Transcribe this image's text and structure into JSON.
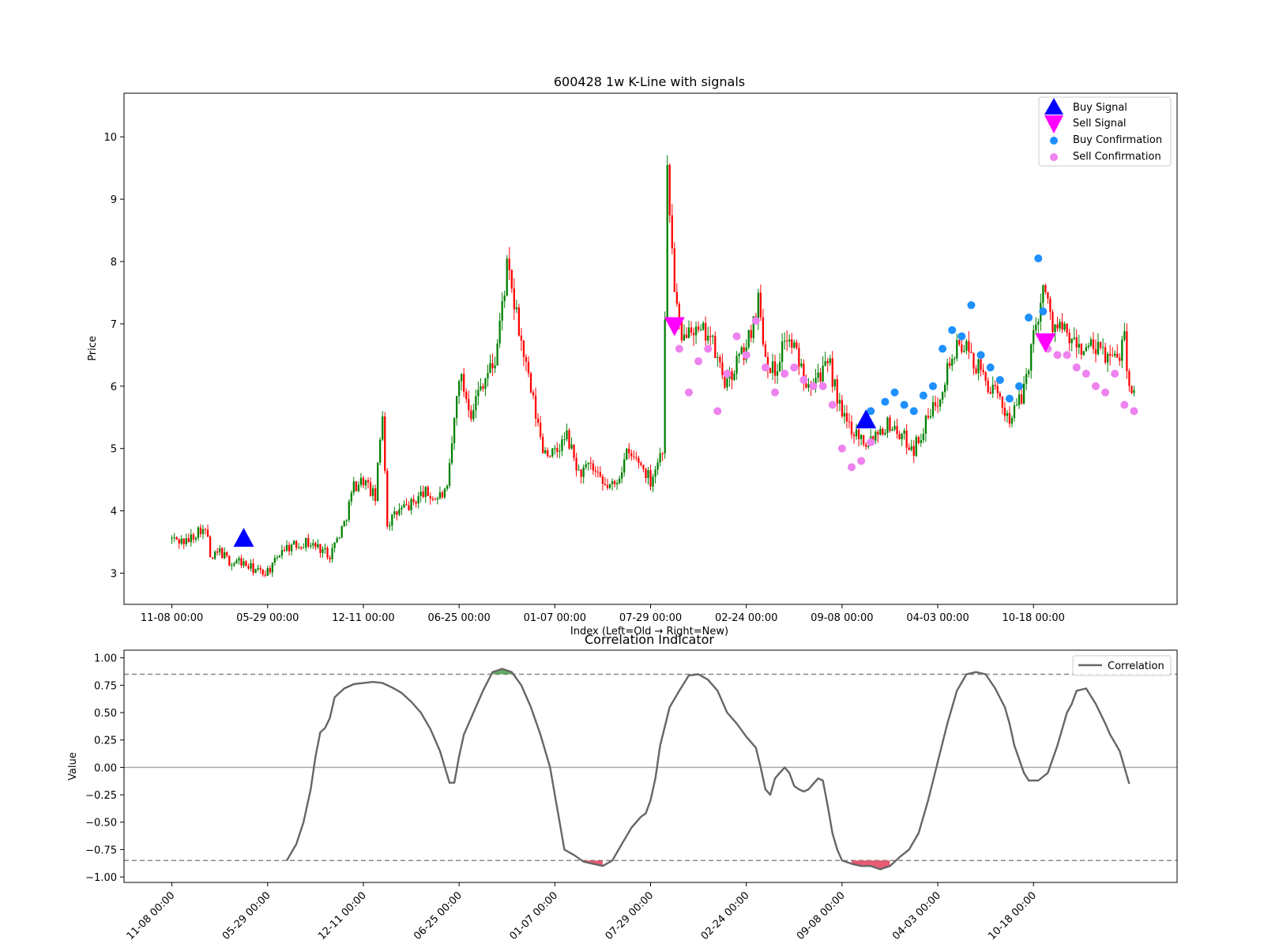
{
  "chart_data": [
    {
      "type": "candlestick",
      "title": "600428 1w K-Line with signals",
      "xlabel": "Index (Left=Old → Right=New)",
      "ylabel": "Price",
      "ylim": [
        2.5,
        10.7
      ],
      "y_ticks": [
        3,
        4,
        5,
        6,
        7,
        8,
        9,
        10
      ],
      "x_tick_labels": [
        "11-08 00:00",
        "05-29 00:00",
        "12-11 00:00",
        "06-25 00:00",
        "01-07 00:00",
        "07-29 00:00",
        "02-24 00:00",
        "09-08 00:00",
        "04-03 00:00",
        "10-18 00:00"
      ],
      "x_tick_index": [
        0,
        40,
        80,
        120,
        160,
        200,
        240,
        280,
        320,
        360
      ],
      "xlim": [
        -20,
        420
      ],
      "colors": {
        "up": "#008000",
        "down": "#ff0000",
        "buy_signal": "#0000ff",
        "sell_signal": "#ff00ff",
        "buy_confirmation": "#1e90ff",
        "sell_confirmation": "#ee82ee"
      },
      "legend": {
        "placement": "top-right",
        "items": [
          "Buy Signal",
          "Sell Signal",
          "Buy Confirmation",
          "Sell Confirmation"
        ]
      },
      "price_path": [
        [
          0,
          3.55
        ],
        [
          6,
          3.5
        ],
        [
          12,
          3.72
        ],
        [
          15,
          3.6
        ],
        [
          16,
          3.2
        ],
        [
          20,
          3.35
        ],
        [
          25,
          3.15
        ],
        [
          28,
          3.2
        ],
        [
          32,
          3.1
        ],
        [
          38,
          3.0
        ],
        [
          42,
          3.1
        ],
        [
          46,
          3.4
        ],
        [
          52,
          3.45
        ],
        [
          56,
          3.5
        ],
        [
          62,
          3.4
        ],
        [
          66,
          3.3
        ],
        [
          72,
          3.8
        ],
        [
          76,
          4.4
        ],
        [
          80,
          4.5
        ],
        [
          85,
          4.2
        ],
        [
          88,
          5.6
        ],
        [
          90,
          3.8
        ],
        [
          95,
          4.0
        ],
        [
          100,
          4.1
        ],
        [
          105,
          4.3
        ],
        [
          110,
          4.2
        ],
        [
          115,
          4.3
        ],
        [
          120,
          6.2
        ],
        [
          125,
          5.6
        ],
        [
          130,
          6.1
        ],
        [
          135,
          6.4
        ],
        [
          140,
          7.9
        ],
        [
          145,
          6.9
        ],
        [
          150,
          5.9
        ],
        [
          155,
          5.0
        ],
        [
          160,
          4.9
        ],
        [
          165,
          5.2
        ],
        [
          170,
          4.6
        ],
        [
          175,
          4.7
        ],
        [
          180,
          4.4
        ],
        [
          185,
          4.4
        ],
        [
          190,
          4.9
        ],
        [
          195,
          4.8
        ],
        [
          200,
          4.5
        ],
        [
          205,
          5.0
        ],
        [
          207,
          9.4
        ],
        [
          210,
          7.6
        ],
        [
          213,
          6.6
        ],
        [
          216,
          7.1
        ],
        [
          220,
          6.8
        ],
        [
          224,
          6.9
        ],
        [
          228,
          6.4
        ],
        [
          232,
          6.0
        ],
        [
          236,
          6.4
        ],
        [
          240,
          6.6
        ],
        [
          245,
          7.4
        ],
        [
          248,
          6.5
        ],
        [
          252,
          6.2
        ],
        [
          256,
          6.8
        ],
        [
          260,
          6.6
        ],
        [
          265,
          6.1
        ],
        [
          270,
          6.2
        ],
        [
          275,
          6.3
        ],
        [
          280,
          5.5
        ],
        [
          285,
          5.3
        ],
        [
          290,
          5.1
        ],
        [
          295,
          5.3
        ],
        [
          300,
          5.4
        ],
        [
          305,
          5.2
        ],
        [
          310,
          5.0
        ],
        [
          315,
          5.4
        ],
        [
          320,
          5.8
        ],
        [
          325,
          6.4
        ],
        [
          330,
          6.7
        ],
        [
          335,
          6.4
        ],
        [
          340,
          6.1
        ],
        [
          345,
          5.8
        ],
        [
          350,
          5.5
        ],
        [
          355,
          5.8
        ],
        [
          360,
          6.8
        ],
        [
          364,
          7.6
        ],
        [
          368,
          7.0
        ],
        [
          372,
          6.9
        ],
        [
          376,
          6.7
        ],
        [
          380,
          6.6
        ],
        [
          385,
          6.6
        ],
        [
          390,
          6.5
        ],
        [
          395,
          6.4
        ],
        [
          398,
          6.9
        ],
        [
          400,
          5.9
        ],
        [
          402,
          6.0
        ]
      ],
      "buy_signals": [
        [
          30,
          3.55
        ],
        [
          290,
          5.45
        ]
      ],
      "sell_signals": [
        [
          210,
          6.98
        ],
        [
          365,
          6.72
        ]
      ],
      "buy_confirmations": [
        [
          292,
          5.6
        ],
        [
          298,
          5.75
        ],
        [
          302,
          5.9
        ],
        [
          306,
          5.7
        ],
        [
          310,
          5.6
        ],
        [
          314,
          5.85
        ],
        [
          318,
          6.0
        ],
        [
          322,
          6.6
        ],
        [
          326,
          6.9
        ],
        [
          330,
          6.8
        ],
        [
          334,
          7.3
        ],
        [
          338,
          6.5
        ],
        [
          342,
          6.3
        ],
        [
          346,
          6.1
        ],
        [
          350,
          5.8
        ],
        [
          354,
          6.0
        ],
        [
          358,
          7.1
        ],
        [
          362,
          8.05
        ],
        [
          364,
          7.2
        ]
      ],
      "sell_confirmations": [
        [
          212,
          6.6
        ],
        [
          216,
          5.9
        ],
        [
          220,
          6.4
        ],
        [
          224,
          6.6
        ],
        [
          228,
          5.6
        ],
        [
          232,
          6.2
        ],
        [
          236,
          6.8
        ],
        [
          240,
          6.5
        ],
        [
          244,
          7.05
        ],
        [
          248,
          6.3
        ],
        [
          252,
          5.9
        ],
        [
          256,
          6.2
        ],
        [
          260,
          6.3
        ],
        [
          264,
          6.1
        ],
        [
          268,
          6.0
        ],
        [
          272,
          6.0
        ],
        [
          276,
          5.7
        ],
        [
          280,
          5.0
        ],
        [
          284,
          4.7
        ],
        [
          288,
          4.8
        ],
        [
          292,
          5.1
        ],
        [
          366,
          6.6
        ],
        [
          370,
          6.5
        ],
        [
          374,
          6.5
        ],
        [
          378,
          6.3
        ],
        [
          382,
          6.2
        ],
        [
          386,
          6.0
        ],
        [
          390,
          5.9
        ],
        [
          394,
          6.2
        ],
        [
          398,
          5.7
        ],
        [
          402,
          5.6
        ]
      ]
    },
    {
      "type": "line",
      "title": "Correlation Indicator",
      "xlabel": "",
      "ylabel": "Value",
      "ylim": [
        -1.0,
        1.0
      ],
      "y_ticks": [
        -1.0,
        -0.75,
        -0.5,
        -0.25,
        0.0,
        0.25,
        0.5,
        0.75,
        1.0
      ],
      "y_tick_labels": [
        "−1.00",
        "−0.75",
        "−0.50",
        "−0.25",
        "0.00",
        "0.25",
        "0.50",
        "0.75",
        "1.00"
      ],
      "x_tick_labels": [
        "11-08 00:00",
        "05-29 00:00",
        "12-11 00:00",
        "06-25 00:00",
        "01-07 00:00",
        "07-29 00:00",
        "02-24 00:00",
        "09-08 00:00",
        "04-03 00:00",
        "10-18 00:00"
      ],
      "x_tick_index": [
        0,
        40,
        80,
        120,
        160,
        200,
        240,
        280,
        320,
        360
      ],
      "xlim": [
        -20,
        420
      ],
      "thresholds": [
        0.85,
        -0.85
      ],
      "grid": false,
      "legend": {
        "placement": "top-right",
        "items": [
          "Correlation"
        ]
      },
      "series": [
        {
          "name": "Correlation",
          "color": "#666666",
          "points": [
            [
              48,
              -0.85
            ],
            [
              52,
              -0.7
            ],
            [
              55,
              -0.5
            ],
            [
              58,
              -0.2
            ],
            [
              60,
              0.1
            ],
            [
              62,
              0.32
            ],
            [
              64,
              0.36
            ],
            [
              66,
              0.45
            ],
            [
              68,
              0.64
            ],
            [
              72,
              0.72
            ],
            [
              76,
              0.76
            ],
            [
              80,
              0.77
            ],
            [
              84,
              0.78
            ],
            [
              88,
              0.77
            ],
            [
              92,
              0.73
            ],
            [
              96,
              0.68
            ],
            [
              100,
              0.6
            ],
            [
              104,
              0.5
            ],
            [
              108,
              0.35
            ],
            [
              112,
              0.15
            ],
            [
              116,
              -0.14
            ],
            [
              118,
              -0.14
            ],
            [
              120,
              0.1
            ],
            [
              122,
              0.3
            ],
            [
              126,
              0.5
            ],
            [
              130,
              0.7
            ],
            [
              134,
              0.87
            ],
            [
              138,
              0.9
            ],
            [
              142,
              0.87
            ],
            [
              146,
              0.75
            ],
            [
              150,
              0.55
            ],
            [
              154,
              0.3
            ],
            [
              158,
              0.0
            ],
            [
              160,
              -0.25
            ],
            [
              162,
              -0.5
            ],
            [
              164,
              -0.75
            ],
            [
              168,
              -0.8
            ],
            [
              172,
              -0.86
            ],
            [
              176,
              -0.88
            ],
            [
              180,
              -0.9
            ],
            [
              184,
              -0.85
            ],
            [
              188,
              -0.7
            ],
            [
              192,
              -0.55
            ],
            [
              196,
              -0.45
            ],
            [
              198,
              -0.42
            ],
            [
              200,
              -0.3
            ],
            [
              202,
              -0.1
            ],
            [
              204,
              0.2
            ],
            [
              208,
              0.55
            ],
            [
              212,
              0.7
            ],
            [
              216,
              0.84
            ],
            [
              220,
              0.85
            ],
            [
              224,
              0.8
            ],
            [
              228,
              0.7
            ],
            [
              232,
              0.5
            ],
            [
              236,
              0.4
            ],
            [
              240,
              0.28
            ],
            [
              244,
              0.18
            ],
            [
              246,
              0.0
            ],
            [
              248,
              -0.2
            ],
            [
              250,
              -0.25
            ],
            [
              252,
              -0.1
            ],
            [
              254,
              -0.05
            ],
            [
              256,
              0.0
            ],
            [
              258,
              -0.05
            ],
            [
              260,
              -0.17
            ],
            [
              262,
              -0.2
            ],
            [
              264,
              -0.22
            ],
            [
              266,
              -0.2
            ],
            [
              268,
              -0.15
            ],
            [
              270,
              -0.1
            ],
            [
              272,
              -0.12
            ],
            [
              274,
              -0.35
            ],
            [
              276,
              -0.6
            ],
            [
              278,
              -0.75
            ],
            [
              280,
              -0.85
            ],
            [
              284,
              -0.88
            ],
            [
              288,
              -0.9
            ],
            [
              292,
              -0.9
            ],
            [
              296,
              -0.93
            ],
            [
              300,
              -0.9
            ],
            [
              304,
              -0.82
            ],
            [
              308,
              -0.75
            ],
            [
              312,
              -0.6
            ],
            [
              316,
              -0.3
            ],
            [
              320,
              0.05
            ],
            [
              324,
              0.4
            ],
            [
              328,
              0.7
            ],
            [
              332,
              0.85
            ],
            [
              336,
              0.87
            ],
            [
              340,
              0.85
            ],
            [
              344,
              0.72
            ],
            [
              348,
              0.55
            ],
            [
              350,
              0.4
            ],
            [
              352,
              0.2
            ],
            [
              356,
              -0.05
            ],
            [
              358,
              -0.12
            ],
            [
              362,
              -0.12
            ],
            [
              366,
              -0.05
            ],
            [
              370,
              0.2
            ],
            [
              374,
              0.5
            ],
            [
              376,
              0.58
            ],
            [
              378,
              0.7
            ],
            [
              382,
              0.72
            ],
            [
              386,
              0.58
            ],
            [
              390,
              0.4
            ],
            [
              392,
              0.3
            ],
            [
              396,
              0.15
            ],
            [
              400,
              -0.15
            ]
          ]
        }
      ]
    }
  ]
}
